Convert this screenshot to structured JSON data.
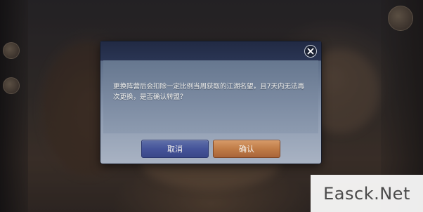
{
  "dialog": {
    "message": "更换阵营后会扣除一定比例当周获取的江湖名望，且7天内无法再次更换，是否确认转盟？",
    "cancel_label": "取消",
    "confirm_label": "确认",
    "close_icon": "close-icon"
  },
  "watermark": {
    "text": "Easck.Net"
  },
  "colors": {
    "cancel_button": "#45549a",
    "confirm_button": "#c07c47",
    "dialog_header": "#212a44"
  }
}
